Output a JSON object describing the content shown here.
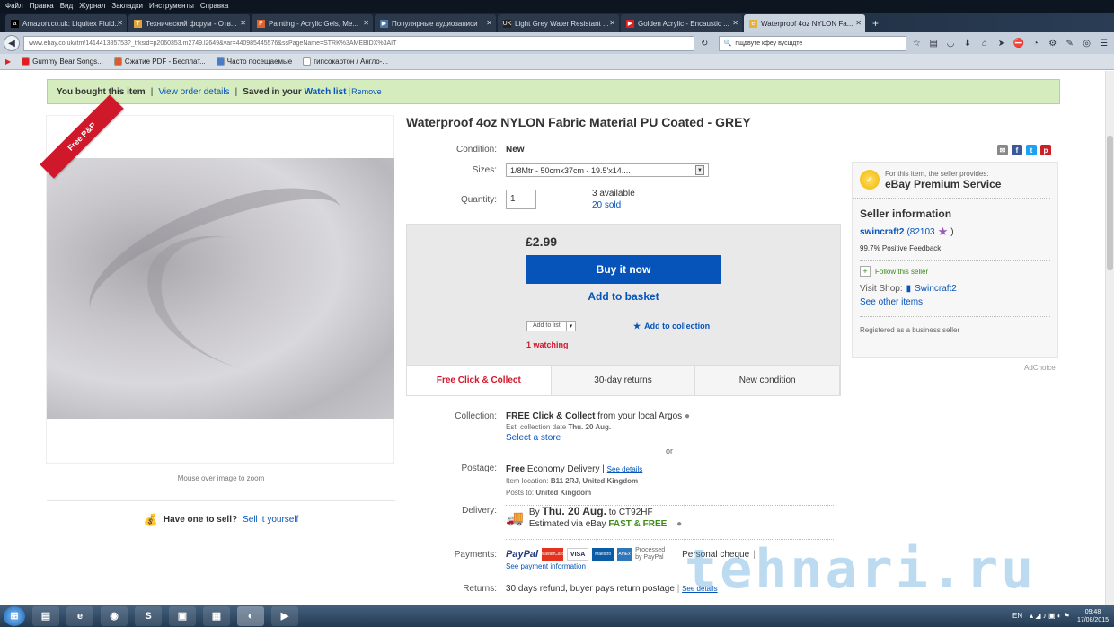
{
  "browser": {
    "menu": [
      "Файл",
      "Правка",
      "Вид",
      "Журнал",
      "Закладки",
      "Инструменты",
      "Справка"
    ],
    "tabs": [
      {
        "title": "Amazon.co.uk: Liquitex Fluid...",
        "icon": "amazon-icon",
        "color": "#000000",
        "glyph": "a"
      },
      {
        "title": "Технический форум - Отв...",
        "icon": "tehnari-icon",
        "color": "#d9a441",
        "glyph": "T"
      },
      {
        "title": "Painting - Acrylic Gels, Me...",
        "icon": "painting-icon",
        "color": "#e0622b",
        "glyph": "P"
      },
      {
        "title": "Популярные аудиозаписи",
        "icon": "audio-icon",
        "color": "#4b76a8",
        "glyph": "▶"
      },
      {
        "title": "Light Grey Water Resistant ...",
        "icon": "uk-icon",
        "color": "#222222",
        "glyph": "UK"
      },
      {
        "title": "Golden Acrylic - Encaustic ...",
        "icon": "youtube-icon",
        "color": "#e02020",
        "glyph": "▶"
      },
      {
        "title": "Waterproof 4oz NYLON Fa...",
        "icon": "ebay-tab-icon",
        "color": "#e5b23a",
        "glyph": "e"
      }
    ],
    "new_tab": "+",
    "url": "www.ebay.co.uk/itm/141441385753?_trksid=p2060353.m2749.l2649&var=440985445576&ssPageName=STRK%3AMEBIDX%3AIT",
    "search_value": "пщдвуте кфеу вусшдте",
    "bookmarks": [
      {
        "label": "Gummy Bear Songs...",
        "color": "#e02020"
      },
      {
        "label": "Сжатие PDF - Бесплат...",
        "color": "#e05b2b"
      },
      {
        "label": "Часто посещаемые",
        "color": "#4a7bc8"
      },
      {
        "label": "гипсокартон / Англо-...",
        "color": "#ffffff"
      }
    ]
  },
  "banner": {
    "bought": "You bought this item",
    "sep1": "|",
    "view_order": "View order details",
    "sep2": "|",
    "saved": "Saved in your",
    "watch_list": "Watch list",
    "sep3": "|",
    "remove": "Remove"
  },
  "gallery": {
    "ribbon": "Free P&P",
    "zoom_hint": "Mouse over image to zoom",
    "have_one": "Have one to sell?",
    "sell_it": "Sell it yourself"
  },
  "item": {
    "title": "Waterproof 4oz NYLON Fabric Material PU Coated - GREY",
    "condition_label": "Condition:",
    "condition_value": "New",
    "sizes_label": "Sizes:",
    "sizes_value": "1/8Mtr - 50cmx37cm - 19.5'x14....",
    "quantity_label": "Quantity:",
    "quantity_value": "1",
    "available": "3 available",
    "sold": "20 sold",
    "price": "£2.99",
    "buy_now": "Buy it now",
    "add_basket": "Add to basket",
    "add_to_list": "Add to list",
    "add_collection": "Add to collection",
    "watching": "1 watching"
  },
  "perks": [
    "Free Click & Collect",
    "30-day returns",
    "New condition"
  ],
  "details": {
    "collection_label": "Collection:",
    "collection_strong": "FREE Click & Collect",
    "collection_rest": "from your local Argos",
    "collection_date_label": "Est. collection date",
    "collection_date": "Thu. 20 Aug.",
    "select_store": "Select a store",
    "or": "or",
    "postage_label": "Postage:",
    "postage_free": "Free",
    "postage_service": "Economy Delivery",
    "postage_sep": "|",
    "see_details": "See details",
    "item_location_label": "Item location:",
    "item_location": "B11 2RJ, United Kingdom",
    "posts_to_label": "Posts to:",
    "posts_to": "United Kingdom",
    "delivery_label": "Delivery:",
    "delivery_by": "By",
    "delivery_date": "Thu. 20 Aug.",
    "delivery_to": "to CT92HF",
    "delivery_est": "Estimated via eBay",
    "fast_free": "FAST & FREE",
    "payments_label": "Payments:",
    "paypal": "PayPal",
    "processed": "Processed by PayPal",
    "cards": [
      "MasterCard",
      "VISA",
      "Maestro",
      "AmEx"
    ],
    "personal_cheque": "Personal cheque",
    "payment_info": "See payment information",
    "returns_label": "Returns:",
    "returns_text": "30 days refund, buyer pays return postage",
    "returns_sep": "|",
    "returns_see": "See details"
  },
  "seller": {
    "provides": "For this item, the seller provides:",
    "premium": "eBay Premium Service",
    "info_title": "Seller information",
    "name": "swincraft2",
    "feedback": "(82103",
    "feedback_close": ")",
    "positive": "99.7% Positive Feedback",
    "follow": "Follow this seller",
    "visit_shop": "Visit Shop:",
    "shop_name": "Swincraft2",
    "see_other": "See other items",
    "registered": "Registered as a business seller",
    "adchoice": "AdChoice"
  },
  "share": [
    {
      "icon": "email-icon",
      "color": "#888888",
      "glyph": "✉"
    },
    {
      "icon": "facebook-icon",
      "color": "#3b5998",
      "glyph": "f"
    },
    {
      "icon": "twitter-icon",
      "color": "#1da1f2",
      "glyph": "t"
    },
    {
      "icon": "pinterest-icon",
      "color": "#cb2027",
      "glyph": "p"
    }
  ],
  "watermark": "tehnari.ru",
  "taskbar": {
    "apps": [
      {
        "icon": "explorer-icon",
        "glyph": "▤"
      },
      {
        "icon": "ie-icon",
        "glyph": "e"
      },
      {
        "icon": "chrome-icon",
        "glyph": "◉"
      },
      {
        "icon": "skype-icon",
        "glyph": "S"
      },
      {
        "icon": "app5-icon",
        "glyph": "▣"
      },
      {
        "icon": "app6-icon",
        "glyph": "▦"
      },
      {
        "icon": "firefox-icon",
        "glyph": "◐"
      },
      {
        "icon": "media-icon",
        "glyph": "▶"
      }
    ],
    "lang": "EN",
    "time": "09:48",
    "date": "17/08/2015"
  },
  "colors": {
    "ebay_blue": "#0654ba",
    "ebay_red": "#d0182b",
    "banner_green": "#d5ecbe",
    "fast_free_green": "#3d8b1b"
  }
}
